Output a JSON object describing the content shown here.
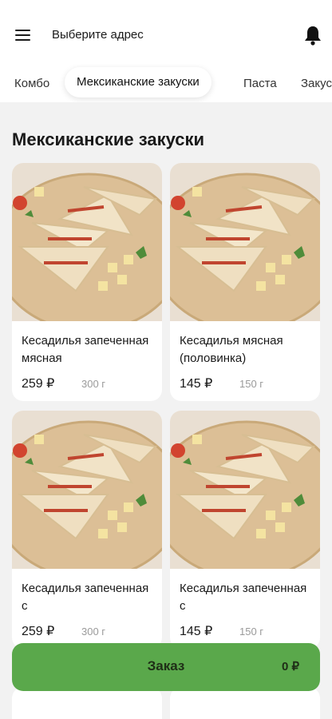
{
  "header": {
    "address_label": "Выберите адрес"
  },
  "tabs": [
    {
      "label": "Комбо",
      "active": false
    },
    {
      "label": "Мексиканские закуски",
      "active": true
    },
    {
      "label": "Паста",
      "active": false
    },
    {
      "label": "Закуски",
      "active": false
    }
  ],
  "section": {
    "title": "Мексиканские закуски"
  },
  "products": [
    {
      "name": "Кесадилья запеченная мясная",
      "price": "259 ₽",
      "weight": "300 г"
    },
    {
      "name": "Кесадилья мясная (половинка)",
      "price": "145 ₽",
      "weight": "150 г"
    },
    {
      "name": "Кесадилья запеченная с",
      "price": "259 ₽",
      "weight": "300 г"
    },
    {
      "name": "Кесадилья запеченная с",
      "price": "145 ₽",
      "weight": "150 г"
    }
  ],
  "order_bar": {
    "label": "Заказ",
    "total": "0 ₽"
  },
  "colors": {
    "accent": "#5aa84b",
    "background": "#f2f2f2"
  },
  "icons": {
    "menu": "hamburger-menu-icon",
    "notifications": "bell-icon"
  }
}
